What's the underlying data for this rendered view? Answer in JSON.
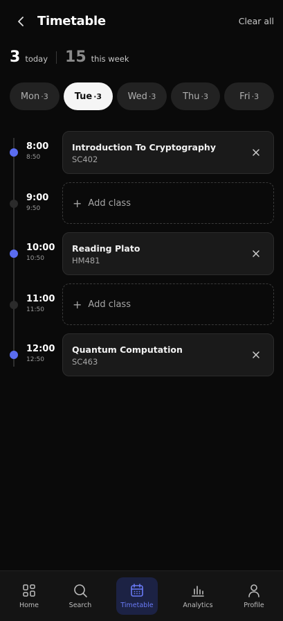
{
  "header": {
    "title": "Timetable",
    "clear_label": "Clear all"
  },
  "stats": {
    "today_count": "3",
    "today_label": "today",
    "week_count": "15",
    "week_label": "this week"
  },
  "days": [
    {
      "name": "Mon",
      "count": "3",
      "active": false
    },
    {
      "name": "Tue",
      "count": "3",
      "active": true
    },
    {
      "name": "Wed",
      "count": "3",
      "active": false
    },
    {
      "name": "Thu",
      "count": "3",
      "active": false
    },
    {
      "name": "Fri",
      "count": "3",
      "active": false
    }
  ],
  "slots": [
    {
      "start": "8:00",
      "end": "8:50",
      "has_class": true,
      "name": "Introduction To Cryptography",
      "code": "SC402"
    },
    {
      "start": "9:00",
      "end": "9:50",
      "has_class": false,
      "add_label": "Add class"
    },
    {
      "start": "10:00",
      "end": "10:50",
      "has_class": true,
      "name": "Reading Plato",
      "code": "HM481"
    },
    {
      "start": "11:00",
      "end": "11:50",
      "has_class": false,
      "add_label": "Add class"
    },
    {
      "start": "12:00",
      "end": "12:50",
      "has_class": true,
      "name": "Quantum Computation",
      "code": "SC463"
    }
  ],
  "nav": [
    {
      "label": "Home",
      "icon": "grid-icon",
      "active": false
    },
    {
      "label": "Search",
      "icon": "search-icon",
      "active": false
    },
    {
      "label": "Timetable",
      "icon": "calendar-icon",
      "active": true
    },
    {
      "label": "Analytics",
      "icon": "bar-chart-icon",
      "active": false
    },
    {
      "label": "Profile",
      "icon": "user-icon",
      "active": false
    }
  ],
  "colors": {
    "accent": "#5a6cf0",
    "background": "#0a0a0a",
    "card": "#1a1a1a"
  }
}
